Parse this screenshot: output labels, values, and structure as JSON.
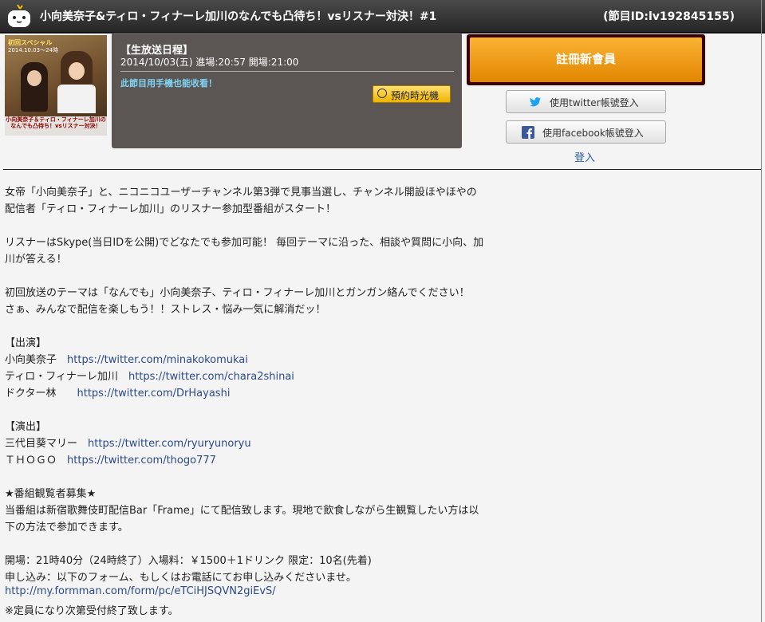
{
  "header": {
    "title": "小向美奈子&ティロ・フィナーレ加川のなんでも凸待ち！vsリスナー対決！#1",
    "program_id": "(節目ID:lv192845155)",
    "logo_icon": "niconico-tv-icon"
  },
  "thumbnail": {
    "line1": "初回スペシャル",
    "line2": "2014.10.03〜24時",
    "caption": "小向美奈子＆ティロ・フィナーレ加川のなんでも凸待ち！vsリスナー対決！"
  },
  "schedule": {
    "heading": "【生放送日程】",
    "datetime": "2014/10/03(五) 進場:20:57 開場:21:00",
    "mobile_note": "此節目用手機也能收看！",
    "reserve_label": "預約時光機"
  },
  "auth": {
    "register_label": "註冊新會員",
    "twitter_label": "使用twitter帳號登入",
    "facebook_label": "使用facebook帳號登入",
    "login_label": "登入"
  },
  "description": {
    "p1_l1": "女帝「小向美奈子」と、ニコニコユーザーチャンネル第3弾で見事当選し、チャンネル開設ほやほやの",
    "p1_l2": "配信者「ティロ・フィナーレ加川」のリスナー参加型番組がスタート！",
    "p2_l1": "リスナーはSkype(当日IDを公開)でどなたでも参加可能！ 毎回テーマに沿った、相談や質問に小向、加",
    "p2_l2": "川が答える！",
    "p3_l1": "初回放送のテーマは「なんでも」小向美奈子、ティロ・フィナーレ加川とガンガン絡んでください！",
    "p3_l2": "さぁ、みんなで配信を楽しもう！！ストレス・悩み一気に解消だッ！",
    "cast_heading": "【出演】",
    "cast": [
      {
        "name": "小向美奈子　",
        "url": "https://twitter.com/minakokomukai"
      },
      {
        "name": "ティロ・フィナーレ加川　",
        "url": "https://twitter.com/chara2shinai"
      },
      {
        "name": "ドクター林　　",
        "url": "https://twitter.com/DrHayashi"
      }
    ],
    "staff_heading": "【演出】",
    "staff": [
      {
        "name": "三代目葵マリー　",
        "url": "https://twitter.com/ryuryunoryu"
      },
      {
        "name": "ＴＨＯＧＯ　",
        "url": "https://twitter.com/thogo777"
      }
    ],
    "viewers_heading": "★番組観覧者募集★",
    "viewers_l1": "当番組は新宿歌舞伎町配信Bar「Frame」にて配信致します。現地で飲食しながら生観覧したい方は以",
    "viewers_l2": "下の方法で参加できます。",
    "info": "開場：21時40分（24時終了）入場料：￥1500＋1ドリンク 限定：10名(先着)",
    "apply": "申し込み：以下のフォーム、もしくはお電話にてお申し込みくださいませ。",
    "form_url": "http://my.formman.com/form/pc/eTCiHJSQVN2giEvS/",
    "note": "※定員になり次第受付終了致します。"
  }
}
